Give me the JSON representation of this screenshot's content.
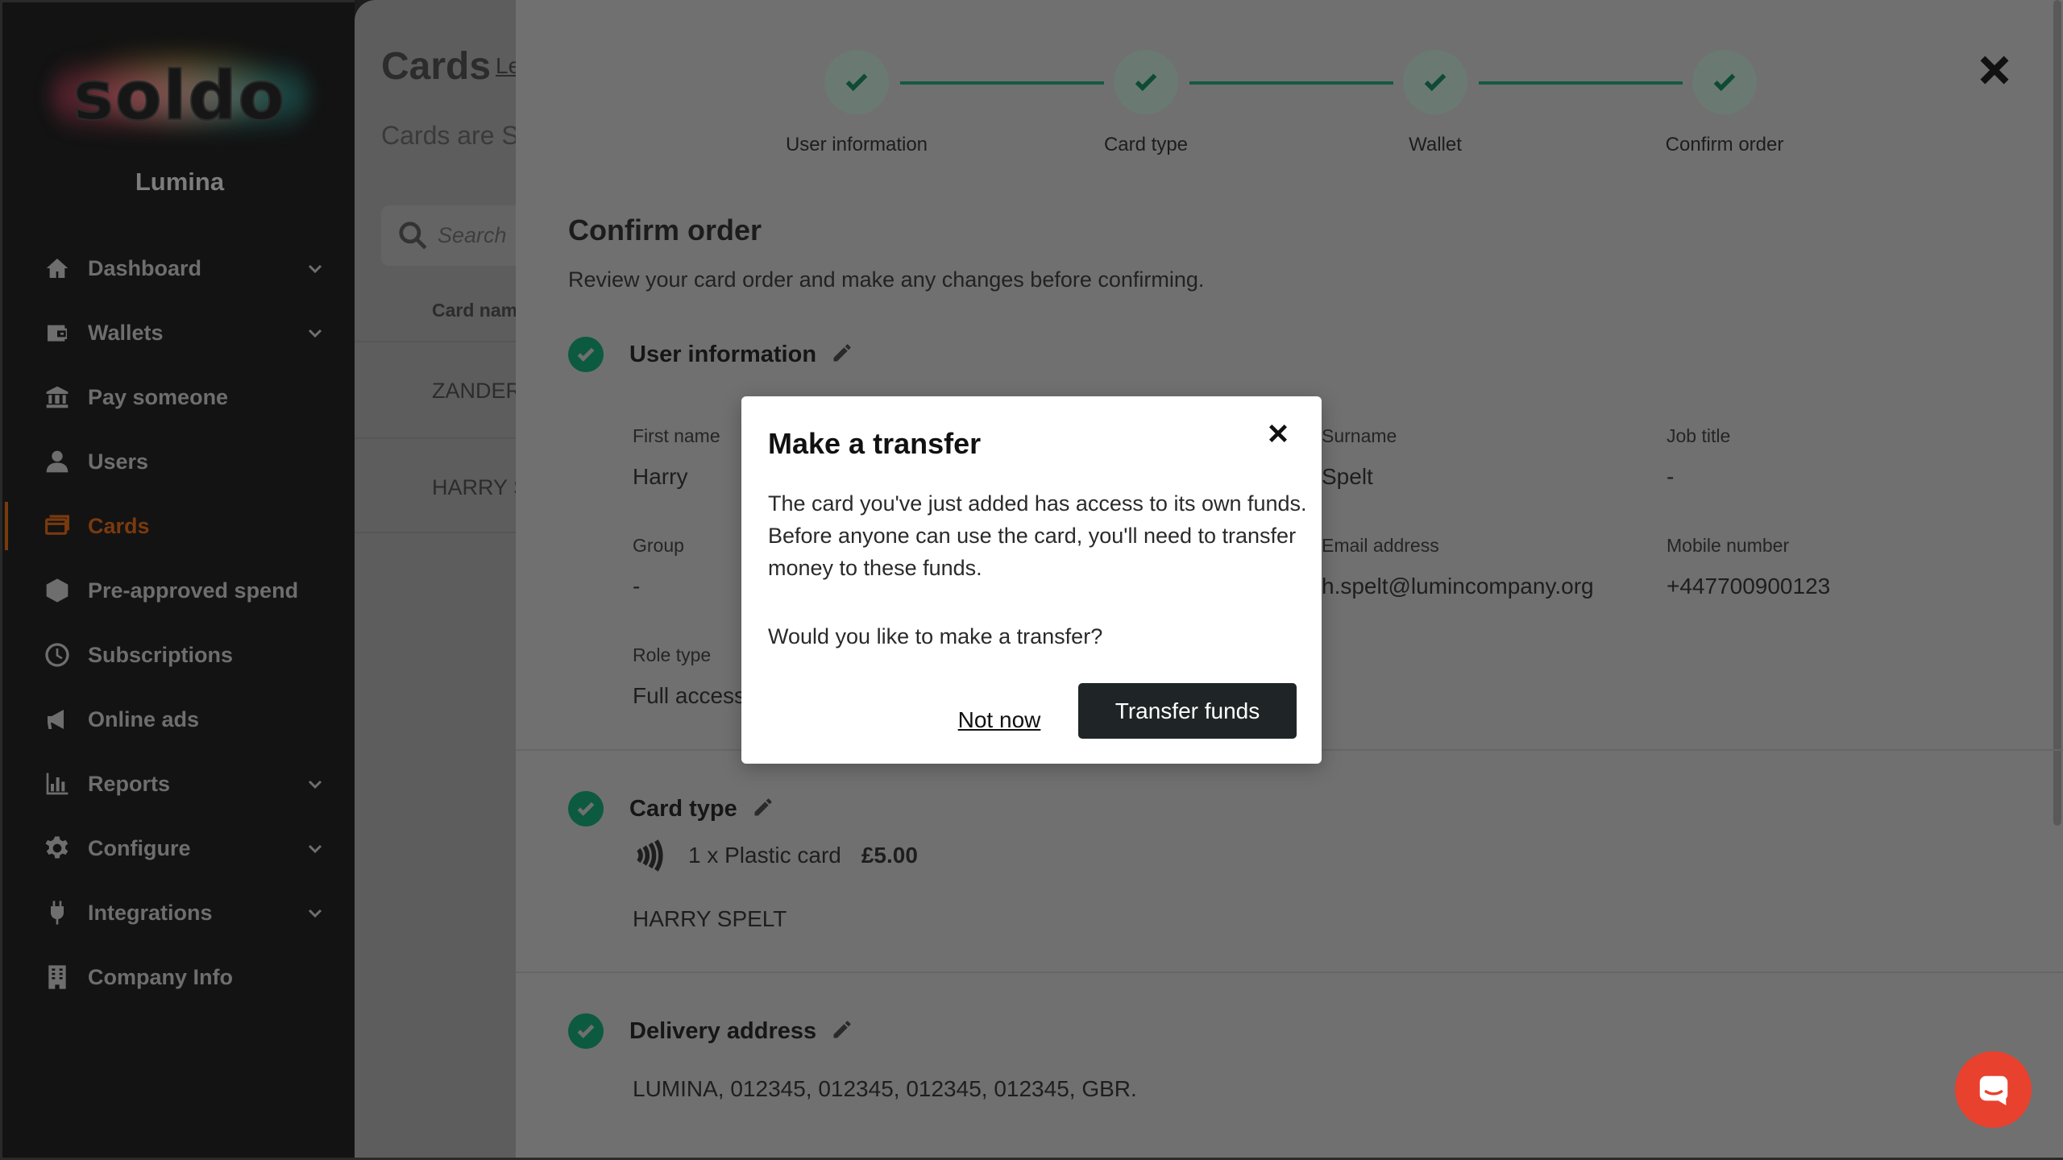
{
  "sidebar": {
    "logo_text": "soldo",
    "org_name": "Lumina",
    "items": [
      {
        "label": "Dashboard",
        "icon": "home-icon",
        "has_chevron": true
      },
      {
        "label": "Wallets",
        "icon": "wallet-icon",
        "has_chevron": true
      },
      {
        "label": "Pay someone",
        "icon": "bank-icon",
        "has_chevron": false
      },
      {
        "label": "Users",
        "icon": "user-icon",
        "has_chevron": false
      },
      {
        "label": "Cards",
        "icon": "card-icon",
        "has_chevron": false,
        "active": true
      },
      {
        "label": "Pre-approved spend",
        "icon": "hexagon-icon",
        "has_chevron": false
      },
      {
        "label": "Subscriptions",
        "icon": "clock-icon",
        "has_chevron": false
      },
      {
        "label": "Online ads",
        "icon": "megaphone-icon",
        "has_chevron": false
      },
      {
        "label": "Reports",
        "icon": "bar-chart-icon",
        "has_chevron": true
      },
      {
        "label": "Configure",
        "icon": "gear-icon",
        "has_chevron": true
      },
      {
        "label": "Integrations",
        "icon": "plug-icon",
        "has_chevron": true
      },
      {
        "label": "Company Info",
        "icon": "building-icon",
        "has_chevron": false
      }
    ]
  },
  "cards_page": {
    "title": "Cards",
    "learn_link": "Le",
    "subtitle": "Cards are So",
    "search_placeholder": "Search",
    "column_header": "Card nam",
    "rows": [
      "ZANDER",
      "HARRY S"
    ]
  },
  "stepper": {
    "steps": [
      "User information",
      "Card type",
      "Wallet",
      "Confirm order"
    ],
    "completed": 4
  },
  "confirm": {
    "title": "Confirm order",
    "subtitle": "Review your card order and make any changes before confirming.",
    "user_info": {
      "heading": "User information",
      "first_name_label": "First name",
      "first_name": "Harry",
      "surname_label": "Surname",
      "surname": "Spelt",
      "job_title_label": "Job title",
      "job_title": "-",
      "group_label": "Group",
      "group": "-",
      "email_label": "Email address",
      "email": "h.spelt@lumincompany.org",
      "mobile_label": "Mobile number",
      "mobile": "+447700900123",
      "role_label": "Role type",
      "role": "Full access"
    },
    "card_type": {
      "heading": "Card type",
      "item": "1 x Plastic card",
      "price": "£5.00",
      "name_on_card": "HARRY SPELT"
    },
    "delivery": {
      "heading": "Delivery address",
      "address": "LUMINA, 012345, 012345, 012345, 012345, GBR."
    }
  },
  "modal": {
    "title": "Make a transfer",
    "body": "The card you've just added has access to its own funds. Before anyone can use the card, you'll need to transfer money to these funds.",
    "question": "Would you like to make a transfer?",
    "secondary_button": "Not now",
    "primary_button": "Transfer funds"
  },
  "colors": {
    "accent_green": "#0c5a40",
    "chat_red": "#e8412e",
    "primary_button": "#1f2526"
  }
}
